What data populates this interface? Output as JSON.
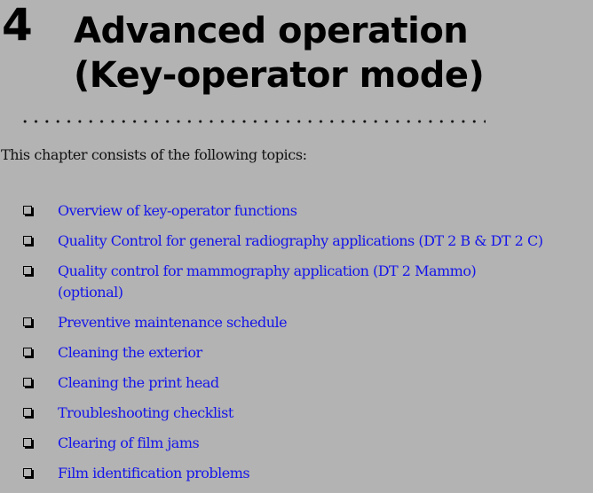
{
  "chapter": {
    "number": "4",
    "title_line1": "Advanced operation",
    "title_line2": "(Key-operator mode)"
  },
  "intro": "This chapter consists of the following topics:",
  "topics": [
    {
      "label": "Overview of key-operator functions",
      "icon": "checkbox-icon"
    },
    {
      "label": "Quality Control for general radiography applications (DT 2 B & DT 2 C)",
      "icon": "checkbox-icon"
    },
    {
      "label": "Quality control for mammography application (DT 2 Mammo) (optional)",
      "icon": "checkbox-icon"
    },
    {
      "label": "Preventive maintenance schedule",
      "icon": "checkbox-icon"
    },
    {
      "label": "Cleaning the exterior",
      "icon": "checkbox-icon"
    },
    {
      "label": "Cleaning the print head",
      "icon": "checkbox-icon"
    },
    {
      "label": "Troubleshooting checklist",
      "icon": "checkbox-icon"
    },
    {
      "label": "Clearing of film jams",
      "icon": "checkbox-icon"
    },
    {
      "label": "Film identification problems",
      "icon": "checkbox-icon"
    }
  ],
  "colors": {
    "background": "#b3b3b3",
    "link": "#1515ea",
    "text": "#111111"
  }
}
